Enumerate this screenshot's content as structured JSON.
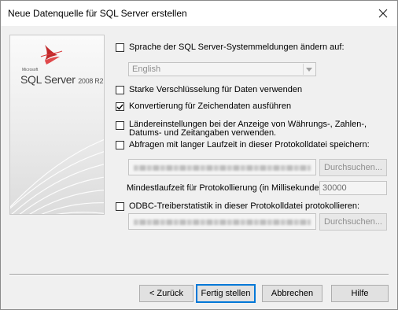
{
  "window": {
    "title": "Neue Datenquelle für SQL Server erstellen"
  },
  "banner": {
    "microsoft": "Microsoft",
    "product": "SQL Server",
    "version": "2008 R2"
  },
  "options": {
    "change_language": {
      "label": "Sprache der SQL Server-Systemmeldungen ändern auf:",
      "checked": false
    },
    "language_select": {
      "value": "English"
    },
    "strong_encryption": {
      "label": "Starke Verschlüsselung für Daten verwenden",
      "checked": false
    },
    "char_conversion": {
      "label": "Konvertierung für Zeichendaten ausführen",
      "checked": true
    },
    "regional_settings": {
      "label": "Ländereinstellungen bei der Anzeige von Währungs-, Zahlen-, Datums- und Zeitangaben verwenden.",
      "checked": false
    },
    "long_queries": {
      "label": "Abfragen mit langer Laufzeit in dieser Protokolldatei speichern:",
      "checked": false,
      "browse_label": "Durchsuchen..."
    },
    "min_runtime": {
      "label": "Mindestlaufzeit für Protokollierung (in Millisekunden):",
      "value": "30000"
    },
    "odbc_stats": {
      "label": "ODBC-Treiberstatistik in dieser Protokolldatei protokollieren:",
      "checked": false,
      "browse_label": "Durchsuchen..."
    }
  },
  "buttons": {
    "back": "< Zurück",
    "finish": "Fertig stellen",
    "cancel": "Abbrechen",
    "help": "Hilfe"
  },
  "colors": {
    "accent": "#0078d7",
    "disabled_text": "#8f8f8f",
    "logo_red": "#c0282a"
  }
}
